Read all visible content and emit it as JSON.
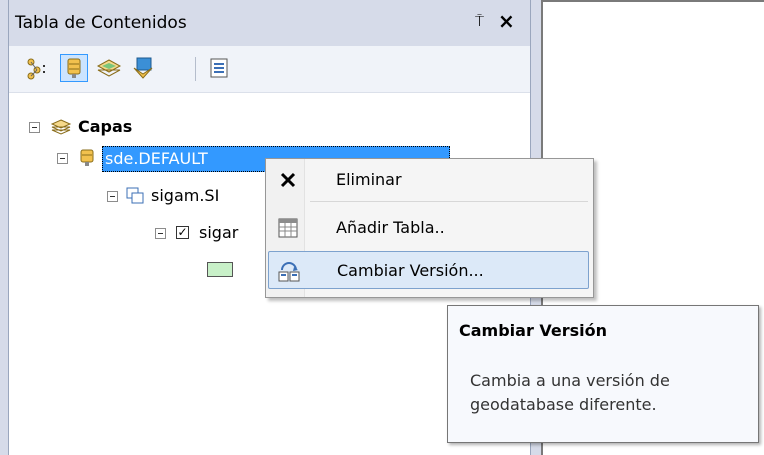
{
  "toc": {
    "title": "Tabla de Contenidos",
    "pin_glyph": "⍑",
    "close_glyph": "×",
    "toolbar": {
      "buttons": [
        {
          "name": "list-by-drawing-order",
          "icon": "list-drawing-order-icon",
          "selected": false
        },
        {
          "name": "list-by-source",
          "icon": "database-source-icon",
          "selected": true
        },
        {
          "name": "list-by-visibility",
          "icon": "layers-visibility-icon",
          "selected": false
        },
        {
          "name": "list-by-selection",
          "icon": "selection-icon",
          "selected": false
        },
        {
          "name": "options",
          "icon": "options-icon",
          "selected": false
        }
      ]
    },
    "tree": {
      "root_label": "Capas",
      "connection_label": "sde.DEFAULT",
      "dataset_label": "sigam.SI",
      "layer_label": "sigar",
      "layer_checked": true
    }
  },
  "context_menu": {
    "items": [
      {
        "label": "Eliminar",
        "icon": "delete-icon",
        "hover": false
      },
      {
        "label": "Añadir Tabla..",
        "icon": "add-table-icon",
        "hover": false
      },
      {
        "label": "Cambiar Versión...",
        "icon": "change-version-icon",
        "hover": true
      }
    ]
  },
  "tooltip": {
    "title": "Cambiar Versión",
    "body": "Cambia a una versión de geodatabase diferente."
  },
  "colors": {
    "selection": "#3399ff",
    "menu_hover": "#dce9f8",
    "symbol_fill": "#c8f0c8"
  }
}
